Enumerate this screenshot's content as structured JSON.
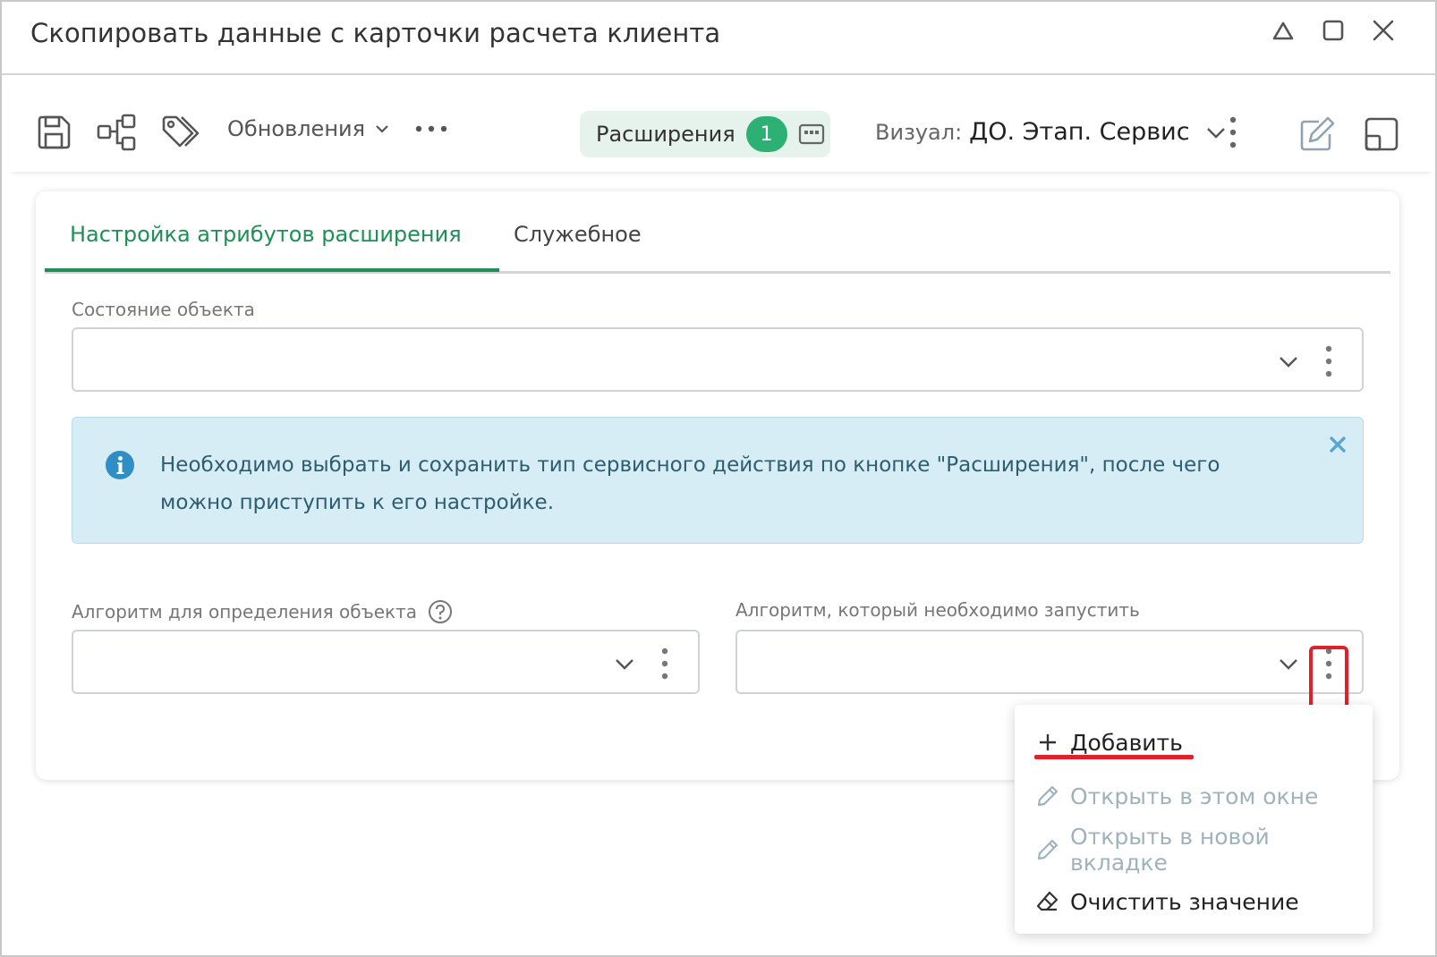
{
  "window": {
    "title": "Скопировать данные с карточки расчета клиента"
  },
  "toolbar": {
    "updates_label": "Обновления",
    "extensions_label": "Расширения",
    "extensions_count": "1",
    "visual_label": "Визуал:",
    "visual_value": "ДО. Этап. Сервис"
  },
  "tabs": [
    {
      "label": "Настройка атрибутов расширения",
      "active": true
    },
    {
      "label": "Служебное",
      "active": false
    }
  ],
  "fields": {
    "object_state": {
      "label": "Состояние объекта",
      "value": ""
    },
    "object_algorithm": {
      "label": "Алгоритм для определения объекта",
      "value": ""
    },
    "run_algorithm": {
      "label": "Алгоритм, который необходимо запустить",
      "value": ""
    }
  },
  "info": {
    "text": "Необходимо выбрать и сохранить тип сервисного действия по кнопке \"Расширения\", после чего можно приступить к его настройке."
  },
  "context_menu": {
    "items": [
      {
        "label": "Добавить",
        "icon": "plus-icon",
        "enabled": true
      },
      {
        "label": "Открыть в этом окне",
        "icon": "pencil-icon",
        "enabled": false
      },
      {
        "label": "Открыть в новой вкладке",
        "icon": "pencil-icon",
        "enabled": false
      },
      {
        "label": "Очистить значение",
        "icon": "eraser-icon",
        "enabled": true
      }
    ]
  },
  "colors": {
    "accent": "#1f8f57",
    "badge": "#2db073",
    "info_bg": "#d6edf6",
    "highlight": "#e0202a"
  }
}
